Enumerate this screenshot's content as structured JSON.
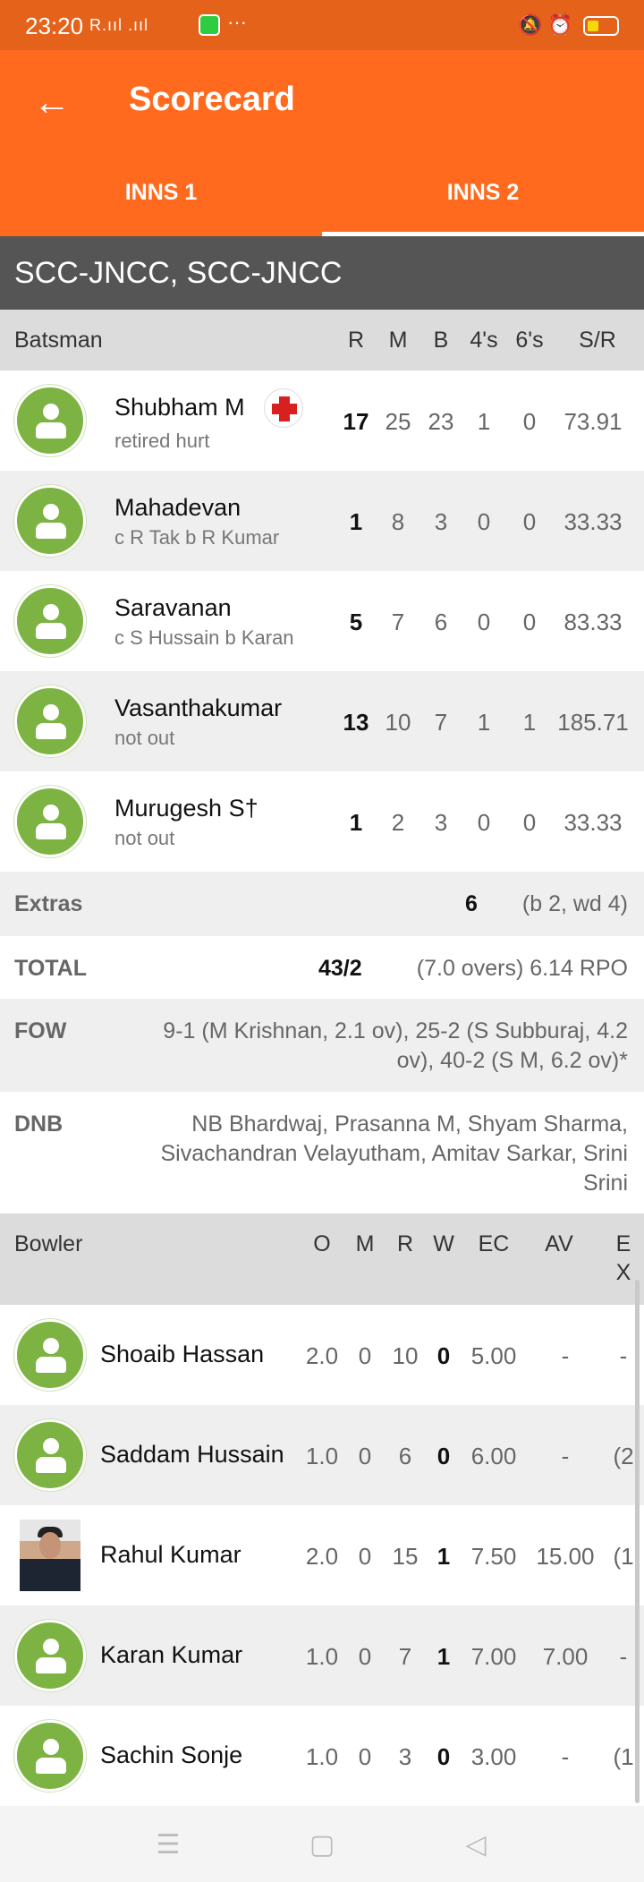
{
  "status_bar": {
    "time": "23:20",
    "signal": "R.ııl .ııl",
    "more": "···"
  },
  "app_bar": {
    "title": "Scorecard",
    "back_icon": "arrow-left-icon"
  },
  "tabs": [
    {
      "label": "INNS 1",
      "active": false
    },
    {
      "label": "INNS 2",
      "active": true
    }
  ],
  "team_name": "SCC-JNCC, SCC-JNCC",
  "batting": {
    "headers": {
      "label": "Batsman",
      "r": "R",
      "m": "M",
      "b": "B",
      "fours": "4's",
      "sixes": "6's",
      "sr": "S/R"
    },
    "rows": [
      {
        "name": "Shubham M",
        "dismissal": "retired hurt",
        "r": "17",
        "m": "25",
        "b": "23",
        "fours": "1",
        "sixes": "0",
        "sr": "73.91"
      },
      {
        "name": "Mahadevan",
        "dismissal": "c R Tak b R Kumar",
        "r": "1",
        "m": "8",
        "b": "3",
        "fours": "0",
        "sixes": "0",
        "sr": "33.33"
      },
      {
        "name": "Saravanan",
        "dismissal": "c S Hussain b Karan",
        "r": "5",
        "m": "7",
        "b": "6",
        "fours": "0",
        "sixes": "0",
        "sr": "83.33"
      },
      {
        "name": "Vasanthakumar",
        "dismissal": "not out",
        "r": "13",
        "m": "10",
        "b": "7",
        "fours": "1",
        "sixes": "1",
        "sr": "185.71"
      },
      {
        "name": "Murugesh S†",
        "dismissal": "not out",
        "r": "1",
        "m": "2",
        "b": "3",
        "fours": "0",
        "sixes": "0",
        "sr": "33.33"
      }
    ]
  },
  "extras": {
    "label": "Extras",
    "value": "6",
    "detail": "(b 2, wd 4)"
  },
  "total": {
    "label": "TOTAL",
    "value": "43/2",
    "detail": "(7.0 overs) 6.14 RPO"
  },
  "fow": {
    "label": "FOW",
    "line1": "9-1 (M Krishnan, 2.1 ov), 25-2 (S Subburaj, 4.2",
    "line2": "ov), 40-2 (S M, 6.2 ov)*"
  },
  "dnb": {
    "label": "DNB",
    "line1": "NB Bhardwaj, Prasanna M, Shyam Sharma,",
    "line2": "Sivachandran Velayutham, Amitav Sarkar, Srini",
    "line3": "Srini"
  },
  "bowling": {
    "headers": {
      "label": "Bowler",
      "o": "O",
      "m": "M",
      "r": "R",
      "w": "W",
      "ec": "EC",
      "av": "AV",
      "ex1": "E",
      "ex2": "X"
    },
    "rows": [
      {
        "name": "Shoaib Hassan",
        "o": "2.0",
        "m": "0",
        "r": "10",
        "w": "0",
        "ec": "5.00",
        "av": "-",
        "ex": "-"
      },
      {
        "name": "Saddam Hussain",
        "o": "1.0",
        "m": "0",
        "r": "6",
        "w": "0",
        "ec": "6.00",
        "av": "-",
        "ex": "(2"
      },
      {
        "name": "Rahul Kumar",
        "o": "2.0",
        "m": "0",
        "r": "15",
        "w": "1",
        "ec": "7.50",
        "av": "15.00",
        "ex": "(1"
      },
      {
        "name": "Karan Kumar",
        "o": "1.0",
        "m": "0",
        "r": "7",
        "w": "1",
        "ec": "7.00",
        "av": "7.00",
        "ex": "-"
      },
      {
        "name": "Sachin Sonje",
        "o": "1.0",
        "m": "0",
        "r": "3",
        "w": "0",
        "ec": "3.00",
        "av": "-",
        "ex": "(1"
      }
    ]
  },
  "nav": {
    "menu_icon": "menu-icon",
    "home_icon": "square-home-icon",
    "back_icon": "triangle-back-icon"
  },
  "colors": {
    "statusbar": "#e5621a",
    "appbar": "#ff6a1f",
    "teambar": "#555555",
    "avatar": "#7cb342"
  }
}
